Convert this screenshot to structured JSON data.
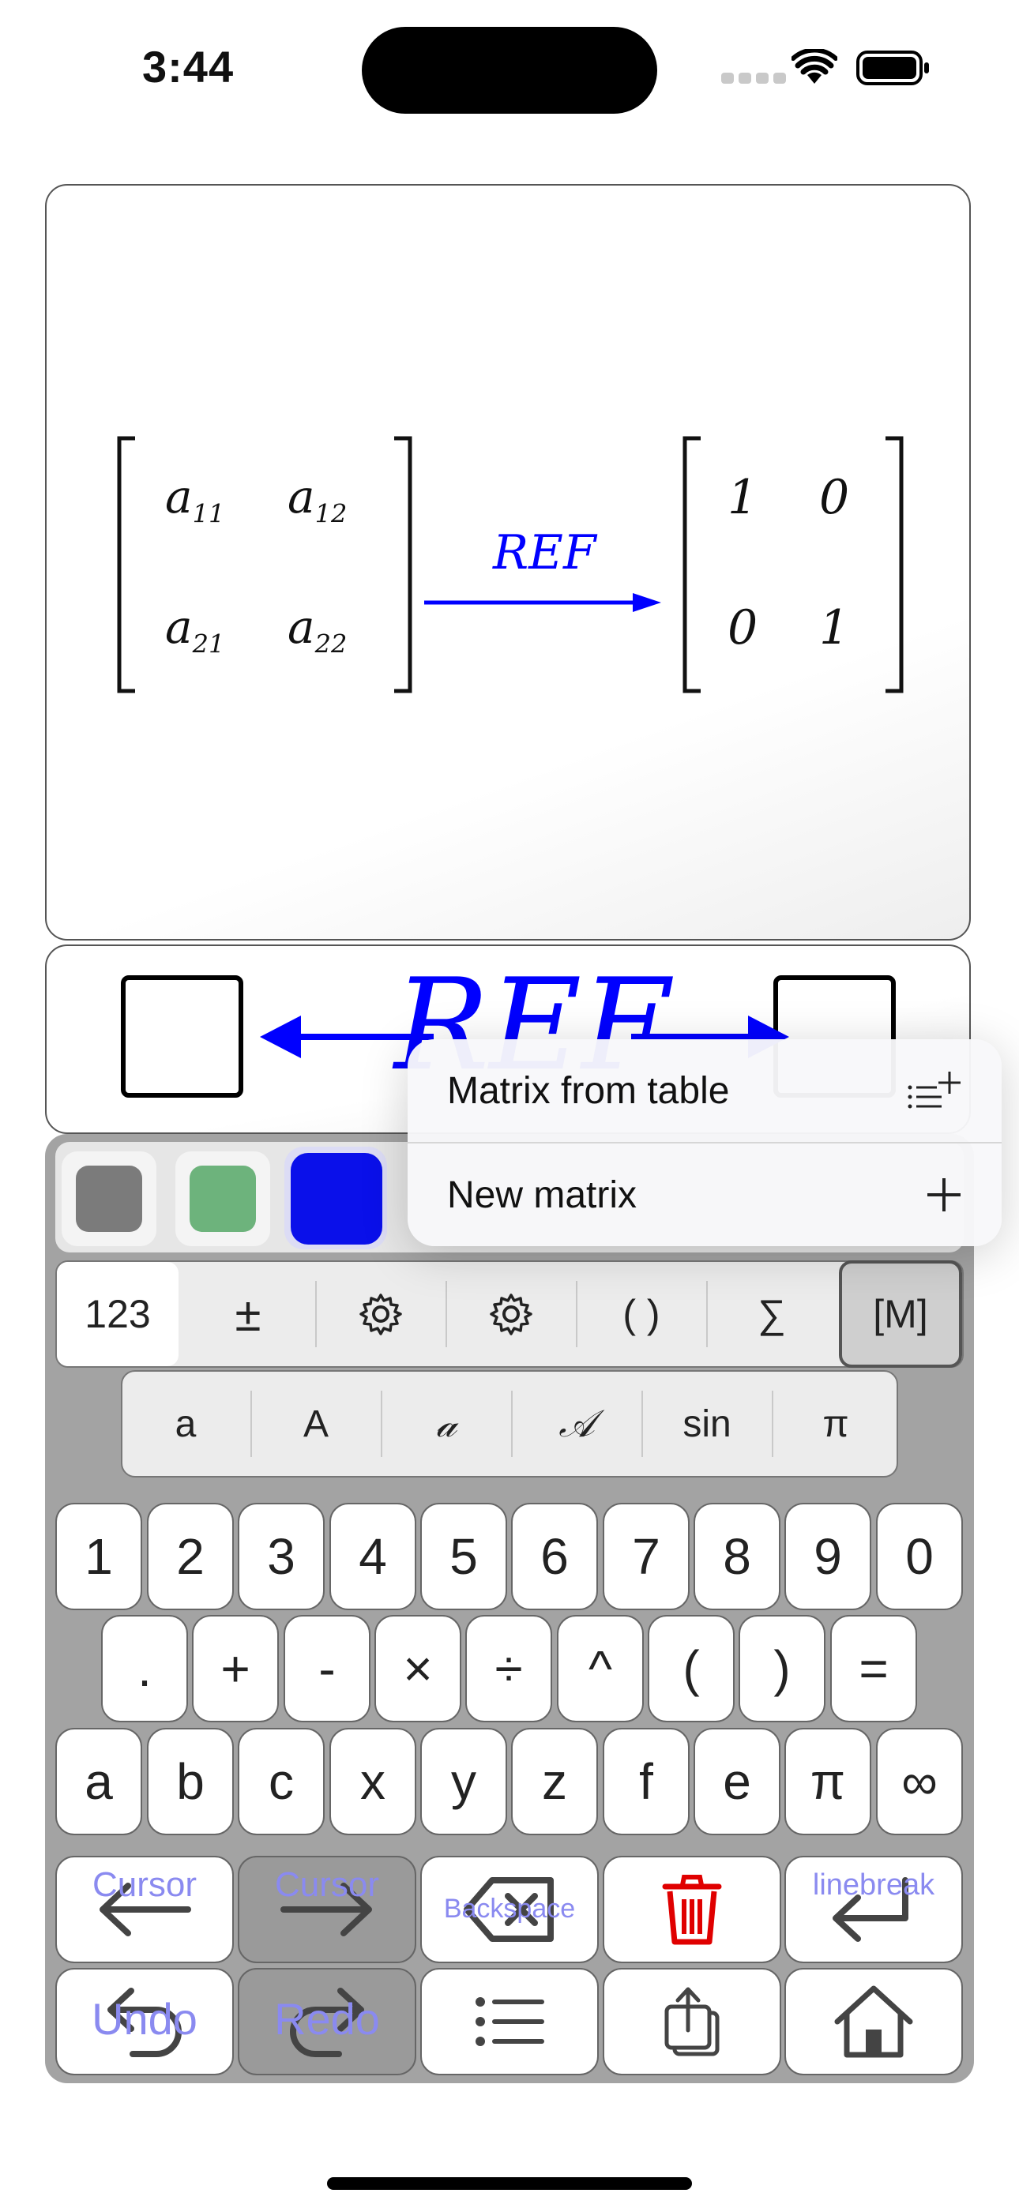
{
  "status": {
    "time": "3:44"
  },
  "preview": {
    "left_matrix": [
      [
        "a",
        "11"
      ],
      [
        "a",
        "12"
      ],
      [
        "a",
        "21"
      ],
      [
        "a",
        "22"
      ]
    ],
    "arrow_label": "REF",
    "right_matrix": [
      "1",
      "0",
      "0",
      "1"
    ]
  },
  "input": {
    "big_label": "REF"
  },
  "colors": {
    "swatches": [
      "#7b7b7b",
      "#6db37c",
      "#0a10ea"
    ],
    "accent": "#0000ff",
    "trash": "#e00000"
  },
  "tabs": [
    "123",
    "±",
    "⚙",
    "⚙",
    "( )",
    "∑",
    "[M]"
  ],
  "fonts": [
    "a",
    "A",
    "𝒶",
    "𝒜",
    "sin",
    "π"
  ],
  "keys": {
    "row1": [
      "1",
      "2",
      "3",
      "4",
      "5",
      "6",
      "7",
      "8",
      "9",
      "0"
    ],
    "row2": [
      ".",
      "+",
      "-",
      "×",
      "÷",
      "^",
      "(",
      ")",
      "="
    ],
    "row3": [
      "a",
      "b",
      "c",
      "x",
      "y",
      "z",
      "f",
      "e",
      "π",
      "∞"
    ]
  },
  "actions": {
    "cursor_left": "Cursor",
    "cursor_right": "Cursor",
    "backspace": "Backspace",
    "linebreak": "linebreak",
    "undo": "Undo",
    "redo": "Redo"
  },
  "menu": {
    "item1": "Matrix from table",
    "item2": "New matrix"
  }
}
